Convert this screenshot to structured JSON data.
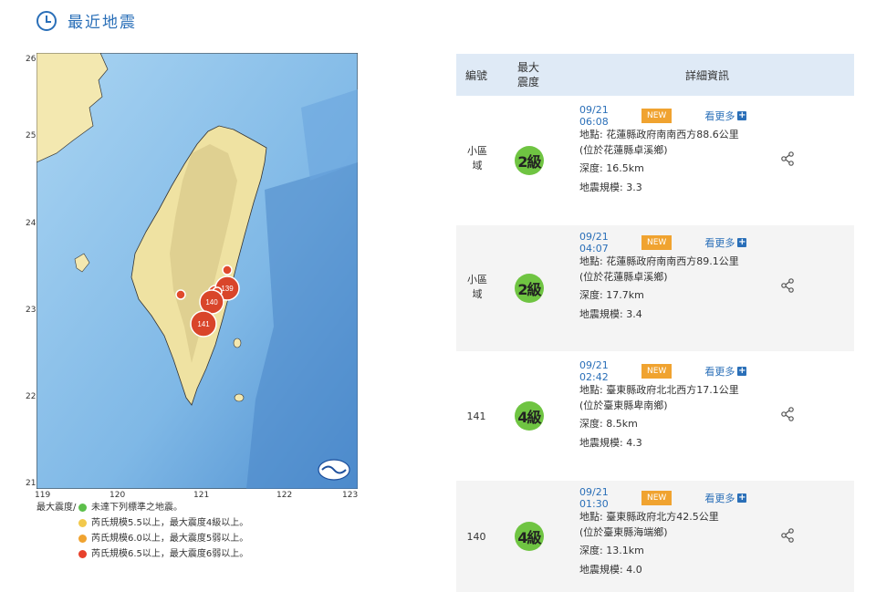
{
  "header": {
    "title": "最近地震"
  },
  "map": {
    "lat_ticks": [
      "26",
      "25",
      "24",
      "23",
      "22",
      "21"
    ],
    "lon_ticks": [
      "119",
      "120",
      "121",
      "122",
      "123"
    ],
    "markers": [
      {
        "label": "139"
      },
      {
        "label": "140"
      },
      {
        "label": "141"
      }
    ]
  },
  "legend": {
    "title": "最大震度/",
    "items": [
      {
        "color": "#5cbf4a",
        "text": "未達下列標準之地震。"
      },
      {
        "color": "#f2c94c",
        "text": "芮氏規模5.5以上，最大震度4級以上。"
      },
      {
        "color": "#f0a330",
        "text": "芮氏規模6.0以上，最大震度5弱以上。"
      },
      {
        "color": "#e8412c",
        "text": "芮氏規模6.5以上，最大震度6弱以上。"
      }
    ]
  },
  "table": {
    "headers": {
      "number": "編號",
      "intensity": "最大震度",
      "details": "詳細資訊"
    },
    "new_label": "NEW",
    "more_label": "看更多",
    "rows": [
      {
        "number": "小區域",
        "intensity": "2級",
        "time": "09/21 06:08",
        "location": "地點: 花蓮縣政府南南西方88.6公里",
        "location_note": "(位於花蓮縣卓溪鄉)",
        "depth": "深度: 16.5km",
        "magnitude": "地震規模: 3.3"
      },
      {
        "number": "小區域",
        "intensity": "2級",
        "time": "09/21 04:07",
        "location": "地點: 花蓮縣政府南南西方89.1公里",
        "location_note": "(位於花蓮縣卓溪鄉)",
        "depth": "深度: 17.7km",
        "magnitude": "地震規模: 3.4"
      },
      {
        "number": "141",
        "intensity": "4級",
        "time": "09/21 02:42",
        "location": "地點: 臺東縣政府北北西方17.1公里",
        "location_note": "(位於臺東縣卑南鄉)",
        "depth": "深度: 8.5km",
        "magnitude": "地震規模: 4.3"
      },
      {
        "number": "140",
        "intensity": "4級",
        "time": "09/21 01:30",
        "location": "地點: 臺東縣政府北方42.5公里",
        "location_note": "(位於臺東縣海端鄉)",
        "depth": "深度: 13.1km",
        "magnitude": "地震規模: 4.0"
      }
    ]
  }
}
